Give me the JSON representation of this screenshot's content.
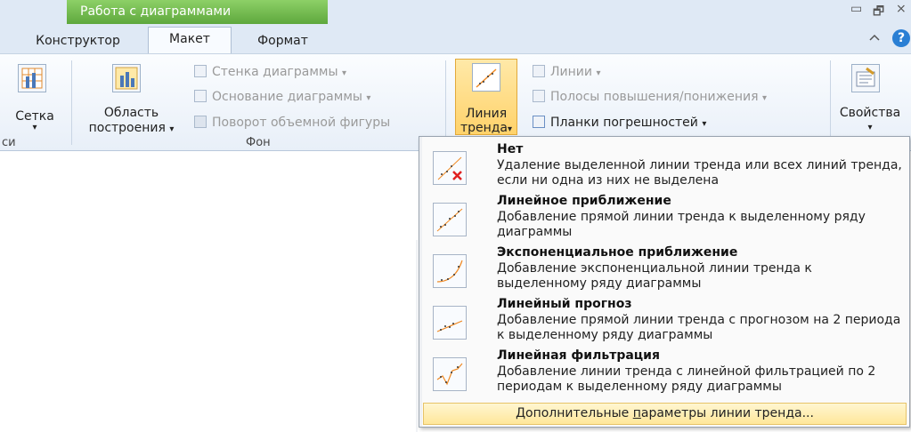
{
  "contextual": {
    "title": "Работа с диаграммами"
  },
  "tabs": [
    {
      "label": "Конструктор"
    },
    {
      "label": "Макет"
    },
    {
      "label": "Формат"
    }
  ],
  "window_controls": {
    "restore": "▭",
    "dock": "🗗",
    "close": "⨯"
  },
  "ribbon": {
    "grid": {
      "label": "Сетка",
      "arrow": "▾",
      "group_label_partial": "си"
    },
    "plot_area": {
      "line1": "Область",
      "line2": "построения",
      "arrow": "▾"
    },
    "wall": {
      "label": "Стенка диаграммы",
      "arrow": "▾"
    },
    "floor": {
      "label": "Основание диаграммы",
      "arrow": "▾"
    },
    "rotation": {
      "label": "Поворот объемной фигуры"
    },
    "background_group": "Фон",
    "trendline": {
      "line1": "Линия",
      "line2": "тренда",
      "arrow": "▾"
    },
    "lines": {
      "label": "Линии",
      "arrow": "▾"
    },
    "updown": {
      "label": "Полосы повышения/понижения",
      "arrow": "▾"
    },
    "errorbars": {
      "label": "Планки погрешностей",
      "arrow": "▾"
    },
    "properties": {
      "label": "Свойства",
      "arrow": "▾"
    }
  },
  "menu": {
    "items": [
      {
        "title": "Нет",
        "desc": "Удаление выделенной линии тренда или всех линий тренда, если ни одна из них не выделена",
        "icon": "trendline-remove-icon"
      },
      {
        "title": "Линейное приближение",
        "desc": "Добавление прямой линии тренда к выделенному ряду диаграммы",
        "icon": "trendline-linear-icon"
      },
      {
        "title": "Экспоненциальное приближение",
        "desc": "Добавление экспоненциальной линии тренда к выделенному ряду диаграммы",
        "icon": "trendline-exponential-icon"
      },
      {
        "title": "Линейный прогноз",
        "desc": "Добавление прямой линии тренда с прогнозом на 2 периода к выделенному ряду диаграммы",
        "icon": "trendline-forecast-icon"
      },
      {
        "title": "Линейная фильтрация",
        "desc": "Добавление линии тренда с линейной фильтрацией по 2 периодам к выделенному ряду диаграммы",
        "icon": "trendline-moving-average-icon"
      }
    ],
    "more": {
      "prefix": "Дополнительные ",
      "accel": "п",
      "suffix": "араметры линии тренда..."
    }
  },
  "colors": {
    "accent_green": "#6cb845",
    "highlight": "#ffd26a",
    "help_blue": "#2a7fd4"
  }
}
